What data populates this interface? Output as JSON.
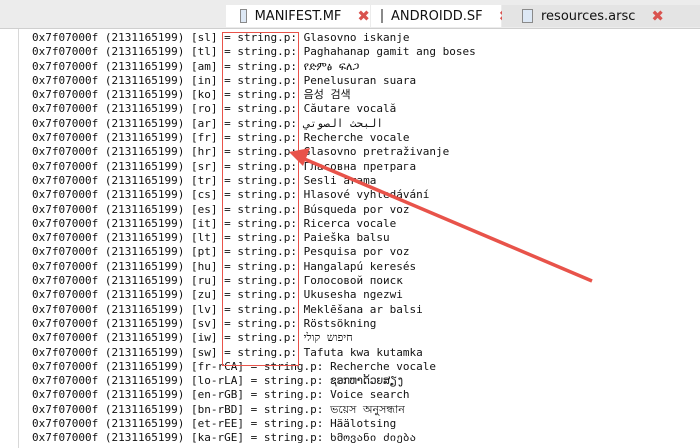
{
  "tabs": [
    {
      "label": "MANIFEST.MF",
      "active": true
    },
    {
      "label": "ANDROIDD.SF",
      "active": true
    },
    {
      "label": "resources.arsc",
      "active": false
    }
  ],
  "accent_color": "#e8534a",
  "lines": [
    {
      "id": "0x7f07000f",
      "dec": "(2131165199)",
      "locale": "[sl]",
      "type": "= string.p:",
      "value": "Glasovno iskanje"
    },
    {
      "id": "0x7f07000f",
      "dec": "(2131165199)",
      "locale": "[tl]",
      "type": "= string.p:",
      "value": "Paghahanap gamit ang boses"
    },
    {
      "id": "0x7f07000f",
      "dec": "(2131165199)",
      "locale": "[am]",
      "type": "= string.p:",
      "value": "የድምፅ ፍለጋ"
    },
    {
      "id": "0x7f07000f",
      "dec": "(2131165199)",
      "locale": "[in]",
      "type": "= string.p:",
      "value": "Penelusuran suara"
    },
    {
      "id": "0x7f07000f",
      "dec": "(2131165199)",
      "locale": "[ko]",
      "type": "= string.p:",
      "value": "음성 검색"
    },
    {
      "id": "0x7f07000f",
      "dec": "(2131165199)",
      "locale": "[ro]",
      "type": "= string.p:",
      "value": "Căutare vocală"
    },
    {
      "id": "0x7f07000f",
      "dec": "(2131165199)",
      "locale": "[ar]",
      "type": "= string.p:",
      "value": "البحث الصوتي"
    },
    {
      "id": "0x7f07000f",
      "dec": "(2131165199)",
      "locale": "[fr]",
      "type": "= string.p:",
      "value": "Recherche vocale"
    },
    {
      "id": "0x7f07000f",
      "dec": "(2131165199)",
      "locale": "[hr]",
      "type": "= string.p:",
      "value": "Glasovno pretraživanje"
    },
    {
      "id": "0x7f07000f",
      "dec": "(2131165199)",
      "locale": "[sr]",
      "type": "= string.p:",
      "value": "Гласовна претрага"
    },
    {
      "id": "0x7f07000f",
      "dec": "(2131165199)",
      "locale": "[tr]",
      "type": "= string.p:",
      "value": "Sesli arama"
    },
    {
      "id": "0x7f07000f",
      "dec": "(2131165199)",
      "locale": "[cs]",
      "type": "= string.p:",
      "value": "Hlasové vyhledávání"
    },
    {
      "id": "0x7f07000f",
      "dec": "(2131165199)",
      "locale": "[es]",
      "type": "= string.p:",
      "value": "Búsqueda por voz"
    },
    {
      "id": "0x7f07000f",
      "dec": "(2131165199)",
      "locale": "[it]",
      "type": "= string.p:",
      "value": "Ricerca vocale"
    },
    {
      "id": "0x7f07000f",
      "dec": "(2131165199)",
      "locale": "[lt]",
      "type": "= string.p:",
      "value": "Paieška balsu"
    },
    {
      "id": "0x7f07000f",
      "dec": "(2131165199)",
      "locale": "[pt]",
      "type": "= string.p:",
      "value": "Pesquisa por voz"
    },
    {
      "id": "0x7f07000f",
      "dec": "(2131165199)",
      "locale": "[hu]",
      "type": "= string.p:",
      "value": "Hangalapú keresés"
    },
    {
      "id": "0x7f07000f",
      "dec": "(2131165199)",
      "locale": "[ru]",
      "type": "= string.p:",
      "value": "Голосовой поиск"
    },
    {
      "id": "0x7f07000f",
      "dec": "(2131165199)",
      "locale": "[zu]",
      "type": "= string.p:",
      "value": "Ukusesha ngezwi"
    },
    {
      "id": "0x7f07000f",
      "dec": "(2131165199)",
      "locale": "[lv]",
      "type": "= string.p:",
      "value": "Meklēšana ar balsi"
    },
    {
      "id": "0x7f07000f",
      "dec": "(2131165199)",
      "locale": "[sv]",
      "type": "= string.p:",
      "value": "Röstsökning"
    },
    {
      "id": "0x7f07000f",
      "dec": "(2131165199)",
      "locale": "[iw]",
      "type": "= string.p:",
      "value": "חיפוש קולי"
    },
    {
      "id": "0x7f07000f",
      "dec": "(2131165199)",
      "locale": "[sw]",
      "type": "= string.p:",
      "value": "Tafuta kwa kutamka"
    },
    {
      "id": "0x7f07000f",
      "dec": "(2131165199)",
      "locale": "[fr-rCA]",
      "type": "= string.p:",
      "value": "Recherche vocale"
    },
    {
      "id": "0x7f07000f",
      "dec": "(2131165199)",
      "locale": "[lo-rLA]",
      "type": "= string.p:",
      "value": "ຊອກຫາດ້ວຍສຽງ"
    },
    {
      "id": "0x7f07000f",
      "dec": "(2131165199)",
      "locale": "[en-rGB]",
      "type": "= string.p:",
      "value": "Voice search"
    },
    {
      "id": "0x7f07000f",
      "dec": "(2131165199)",
      "locale": "[bn-rBD]",
      "type": "= string.p:",
      "value": "ভয়েস অনুসন্ধান"
    },
    {
      "id": "0x7f07000f",
      "dec": "(2131165199)",
      "locale": "[et-rEE]",
      "type": "= string.p:",
      "value": "Häälotsing"
    },
    {
      "id": "0x7f07000f",
      "dec": "(2131165199)",
      "locale": "[ka-rGE]",
      "type": "= string.p:",
      "value": "ხმოვანი ძიება"
    }
  ]
}
